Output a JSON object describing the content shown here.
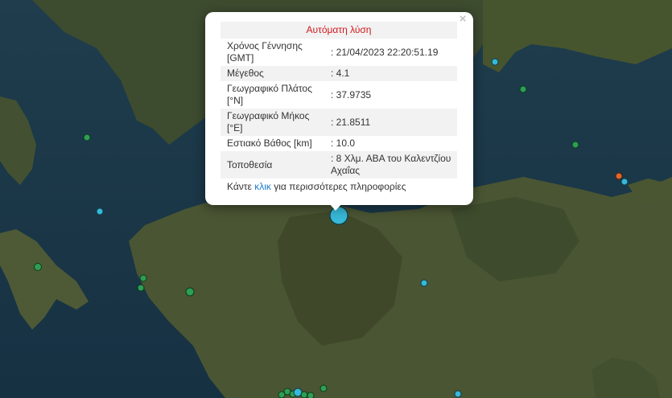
{
  "map": {
    "colors": {
      "sea": "#1c3a4c",
      "land": "#3a4a2c"
    },
    "selected_marker_color": "#37b8d6"
  },
  "popup": {
    "title": "Αυτόματη λύση",
    "rows": [
      {
        "label": "Χρόνος Γέννησης [GMT]",
        "value": ": 21/04/2023 22:20:51.19"
      },
      {
        "label": "Μέγεθος",
        "value": ": 4.1"
      },
      {
        "label": "Γεωγραφικό Πλάτος [°N]",
        "value": ": 37.9735"
      },
      {
        "label": "Γεωγραφικό Μήκος [°E]",
        "value": ": 21.8511"
      },
      {
        "label": "Εστιακό Βάθος [km]",
        "value": ": 10.0"
      },
      {
        "label": "Τοποθεσία",
        "value": ": 8 Χλμ. ΑΒΑ του Καλεντζίου Αχαΐας"
      }
    ],
    "footer_before": "Κάντε ",
    "footer_link": "κλικ",
    "footer_after": " για περισσότερες πληροφορίες",
    "close": "×"
  }
}
